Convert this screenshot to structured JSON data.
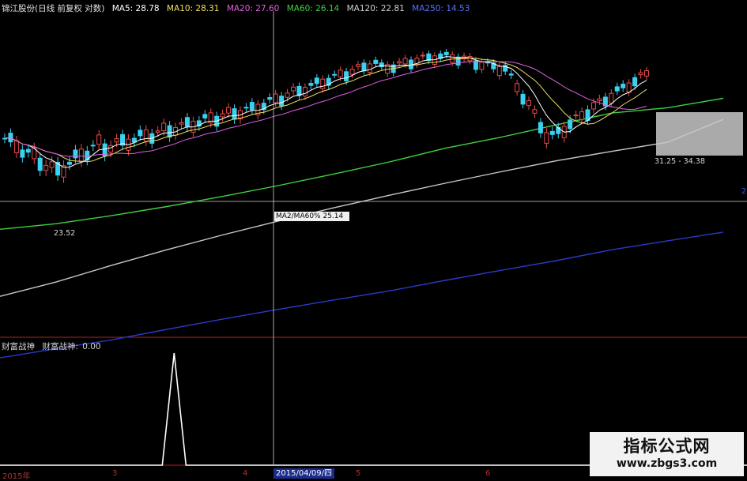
{
  "header": {
    "title": "锦江股份(日线 前复权 对数)",
    "ma": [
      {
        "label": "MA5: 28.78",
        "color": "#ffffff"
      },
      {
        "label": "MA10: 28.31",
        "color": "#f0e060"
      },
      {
        "label": "MA20: 27.60",
        "color": "#e060e0"
      },
      {
        "label": "MA60: 26.14",
        "color": "#40d040"
      },
      {
        "label": "MA120: 22.81",
        "color": "#d0d0d0"
      },
      {
        "label": "MA250: 14.53",
        "color": "#3a50ff"
      }
    ]
  },
  "indicator": {
    "name": "财富战神",
    "label": "财富战神:",
    "value": "0.00"
  },
  "tooltip": "MA2/MA60% 25.14",
  "cursor_date": "2015/04/09/四",
  "x_labels": [
    "2015年",
    "3",
    "4",
    "5",
    "6"
  ],
  "right_marker": "2",
  "chart_data": {
    "type": "candlestick",
    "scale": "log",
    "annotations": {
      "low_label": "23.52",
      "range_label": "31.25 - 34.38"
    },
    "price_ylim": [
      12,
      42
    ],
    "ma_lines": [
      {
        "name": "MA60",
        "color": "#40d040",
        "values": [
          18.2,
          18.6,
          19.2,
          19.9,
          20.7,
          21.6,
          22.6,
          23.7,
          25.0,
          26.1,
          27.4,
          28.7,
          29.3,
          30.4
        ]
      },
      {
        "name": "MA120",
        "color": "#c8c8c8",
        "values": [
          14.0,
          14.8,
          15.8,
          16.8,
          17.8,
          18.8,
          19.8,
          20.8,
          21.8,
          22.8,
          23.8,
          24.7,
          25.6,
          28.0
        ]
      },
      {
        "name": "MA250",
        "color": "#2a3ac8",
        "values": [
          11.0,
          11.4,
          11.8,
          12.3,
          12.8,
          13.3,
          13.8,
          14.3,
          14.9,
          15.5,
          16.1,
          16.8,
          17.4,
          18.0
        ]
      }
    ],
    "indicator_values": [
      0,
      0,
      0,
      0,
      0,
      0,
      0,
      0,
      0,
      0,
      0,
      0,
      1,
      0,
      0,
      0,
      0,
      0,
      0,
      0,
      0,
      0,
      0,
      0,
      0,
      0,
      0,
      0,
      0,
      0,
      0,
      0,
      0,
      0,
      0,
      0,
      0,
      0,
      0,
      0
    ]
  }
}
